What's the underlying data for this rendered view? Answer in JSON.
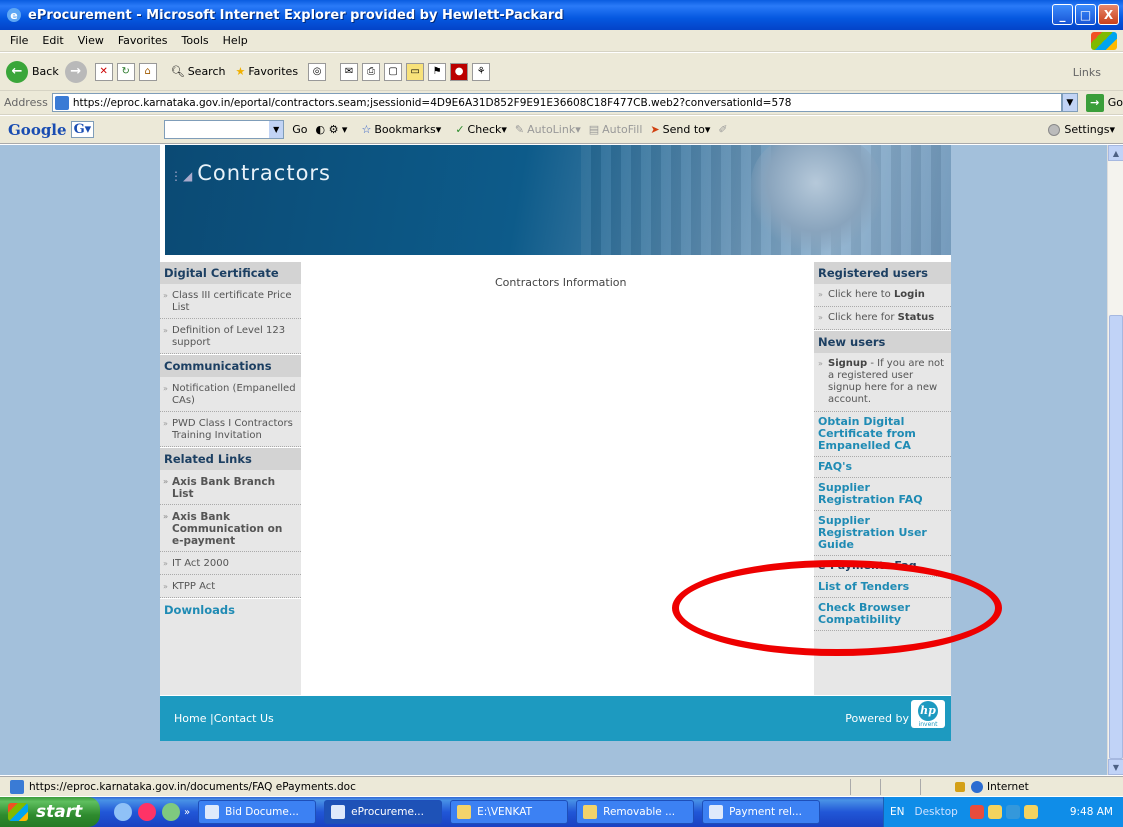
{
  "window": {
    "title": "eProcurement - Microsoft Internet Explorer provided by Hewlett-Packard",
    "buttons": {
      "minimize": "_",
      "maximize": "□",
      "close": "X"
    }
  },
  "menu": [
    "File",
    "Edit",
    "View",
    "Favorites",
    "Tools",
    "Help"
  ],
  "toolbar": {
    "back": "Back",
    "search": "Search",
    "favorites": "Favorites",
    "links": "Links"
  },
  "address": {
    "label": "Address",
    "url": "https://eproc.karnataka.gov.in/eportal/contractors.seam;jsessionid=4D9E6A31D852F9E91E36608C18F477CB.web2?conversationId=578",
    "go": "Go"
  },
  "googlebar": {
    "logo": "Google",
    "go": "Go",
    "bookmarks": "Bookmarks",
    "check": "Check",
    "autolink": "AutoLink",
    "autofill": "AutoFill",
    "sendto": "Send to",
    "settings": "Settings"
  },
  "page": {
    "banner_title": "Contractors",
    "center_heading": "Contractors Information",
    "left": {
      "digital_certificate": {
        "heading": "Digital Certificate",
        "items": [
          "Class III certificate Price List",
          "Definition of Level 123 support"
        ]
      },
      "communications": {
        "heading": "Communications",
        "items": [
          "Notification (Empanelled CAs)",
          "PWD Class I Contractors Training Invitation"
        ]
      },
      "related_links": {
        "heading": "Related Links",
        "items": [
          "Axis Bank Branch List",
          "Axis Bank Communication on e-payment",
          "IT Act 2000",
          "KTPP Act"
        ]
      },
      "downloads": "Downloads"
    },
    "right": {
      "registered_users": {
        "heading": "Registered users",
        "login_prefix": "Click here to ",
        "login": "Login",
        "status_prefix": "Click here for ",
        "status": "Status"
      },
      "new_users": {
        "heading": "New users",
        "signup": "Signup",
        "signup_text": " - If you are not a registered user signup here for a new account."
      },
      "links": [
        "Obtain Digital Certificate from Empanelled CA",
        "FAQ's",
        "Supplier Registration FAQ",
        "Supplier Registration User Guide",
        "e-Payments Faq",
        "List of Tenders",
        "Check Browser Compatibility"
      ]
    },
    "footer": {
      "home": "Home",
      "contact": "|Contact Us",
      "powered_by": "Powered by",
      "hp": "hp",
      "invent": "invent"
    }
  },
  "statusbar": {
    "url": "https://eproc.karnataka.gov.in/documents/FAQ ePayments.doc",
    "zone": "Internet"
  },
  "taskbar": {
    "start": "start",
    "buttons": [
      "Bid Docume...",
      "eProcureme...",
      "E:\\VENKAT",
      "Removable ...",
      "Payment rel..."
    ],
    "lang": "EN",
    "desktop": "Desktop",
    "clock": "9:48 AM"
  }
}
